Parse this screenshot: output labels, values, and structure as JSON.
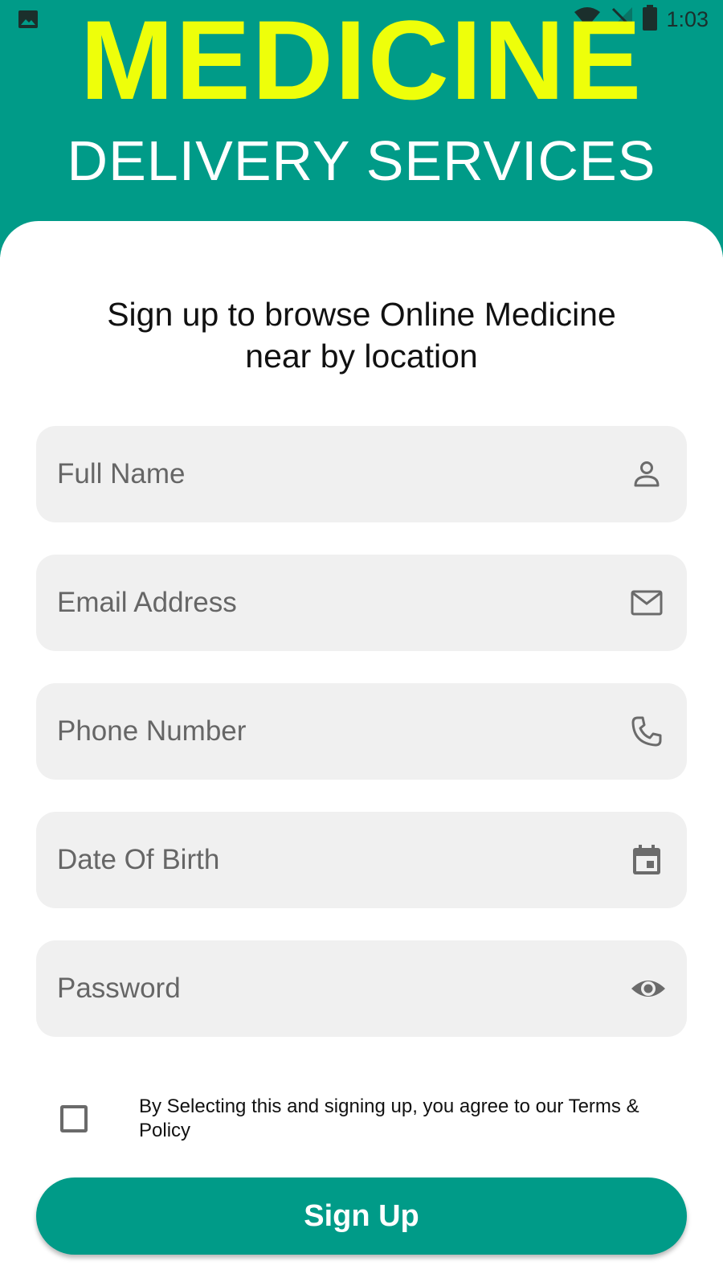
{
  "status_bar": {
    "time": "1:03",
    "icons": [
      "image-icon",
      "wifi-icon",
      "no-signal-icon",
      "battery-icon"
    ]
  },
  "header": {
    "title": "MEDICINE",
    "subtitle": "DELIVERY SERVICES"
  },
  "form": {
    "intro": "Sign up to browse Online Medicine near by location",
    "fields": [
      {
        "placeholder": "Full Name",
        "icon": "person-icon"
      },
      {
        "placeholder": "Email Address",
        "icon": "mail-icon"
      },
      {
        "placeholder": "Phone Number",
        "icon": "phone-icon"
      },
      {
        "placeholder": "Date Of Birth",
        "icon": "calendar-icon"
      },
      {
        "placeholder": "Password",
        "icon": "eye-icon"
      }
    ],
    "terms_text": "By Selecting this and signing up, you agree to our Terms & Policy",
    "terms_checked": false,
    "submit_label": "Sign Up"
  },
  "colors": {
    "primary": "#009B88",
    "title_accent": "#EEFF0A",
    "field_background": "#F0F0F0",
    "placeholder_text": "#666666"
  }
}
